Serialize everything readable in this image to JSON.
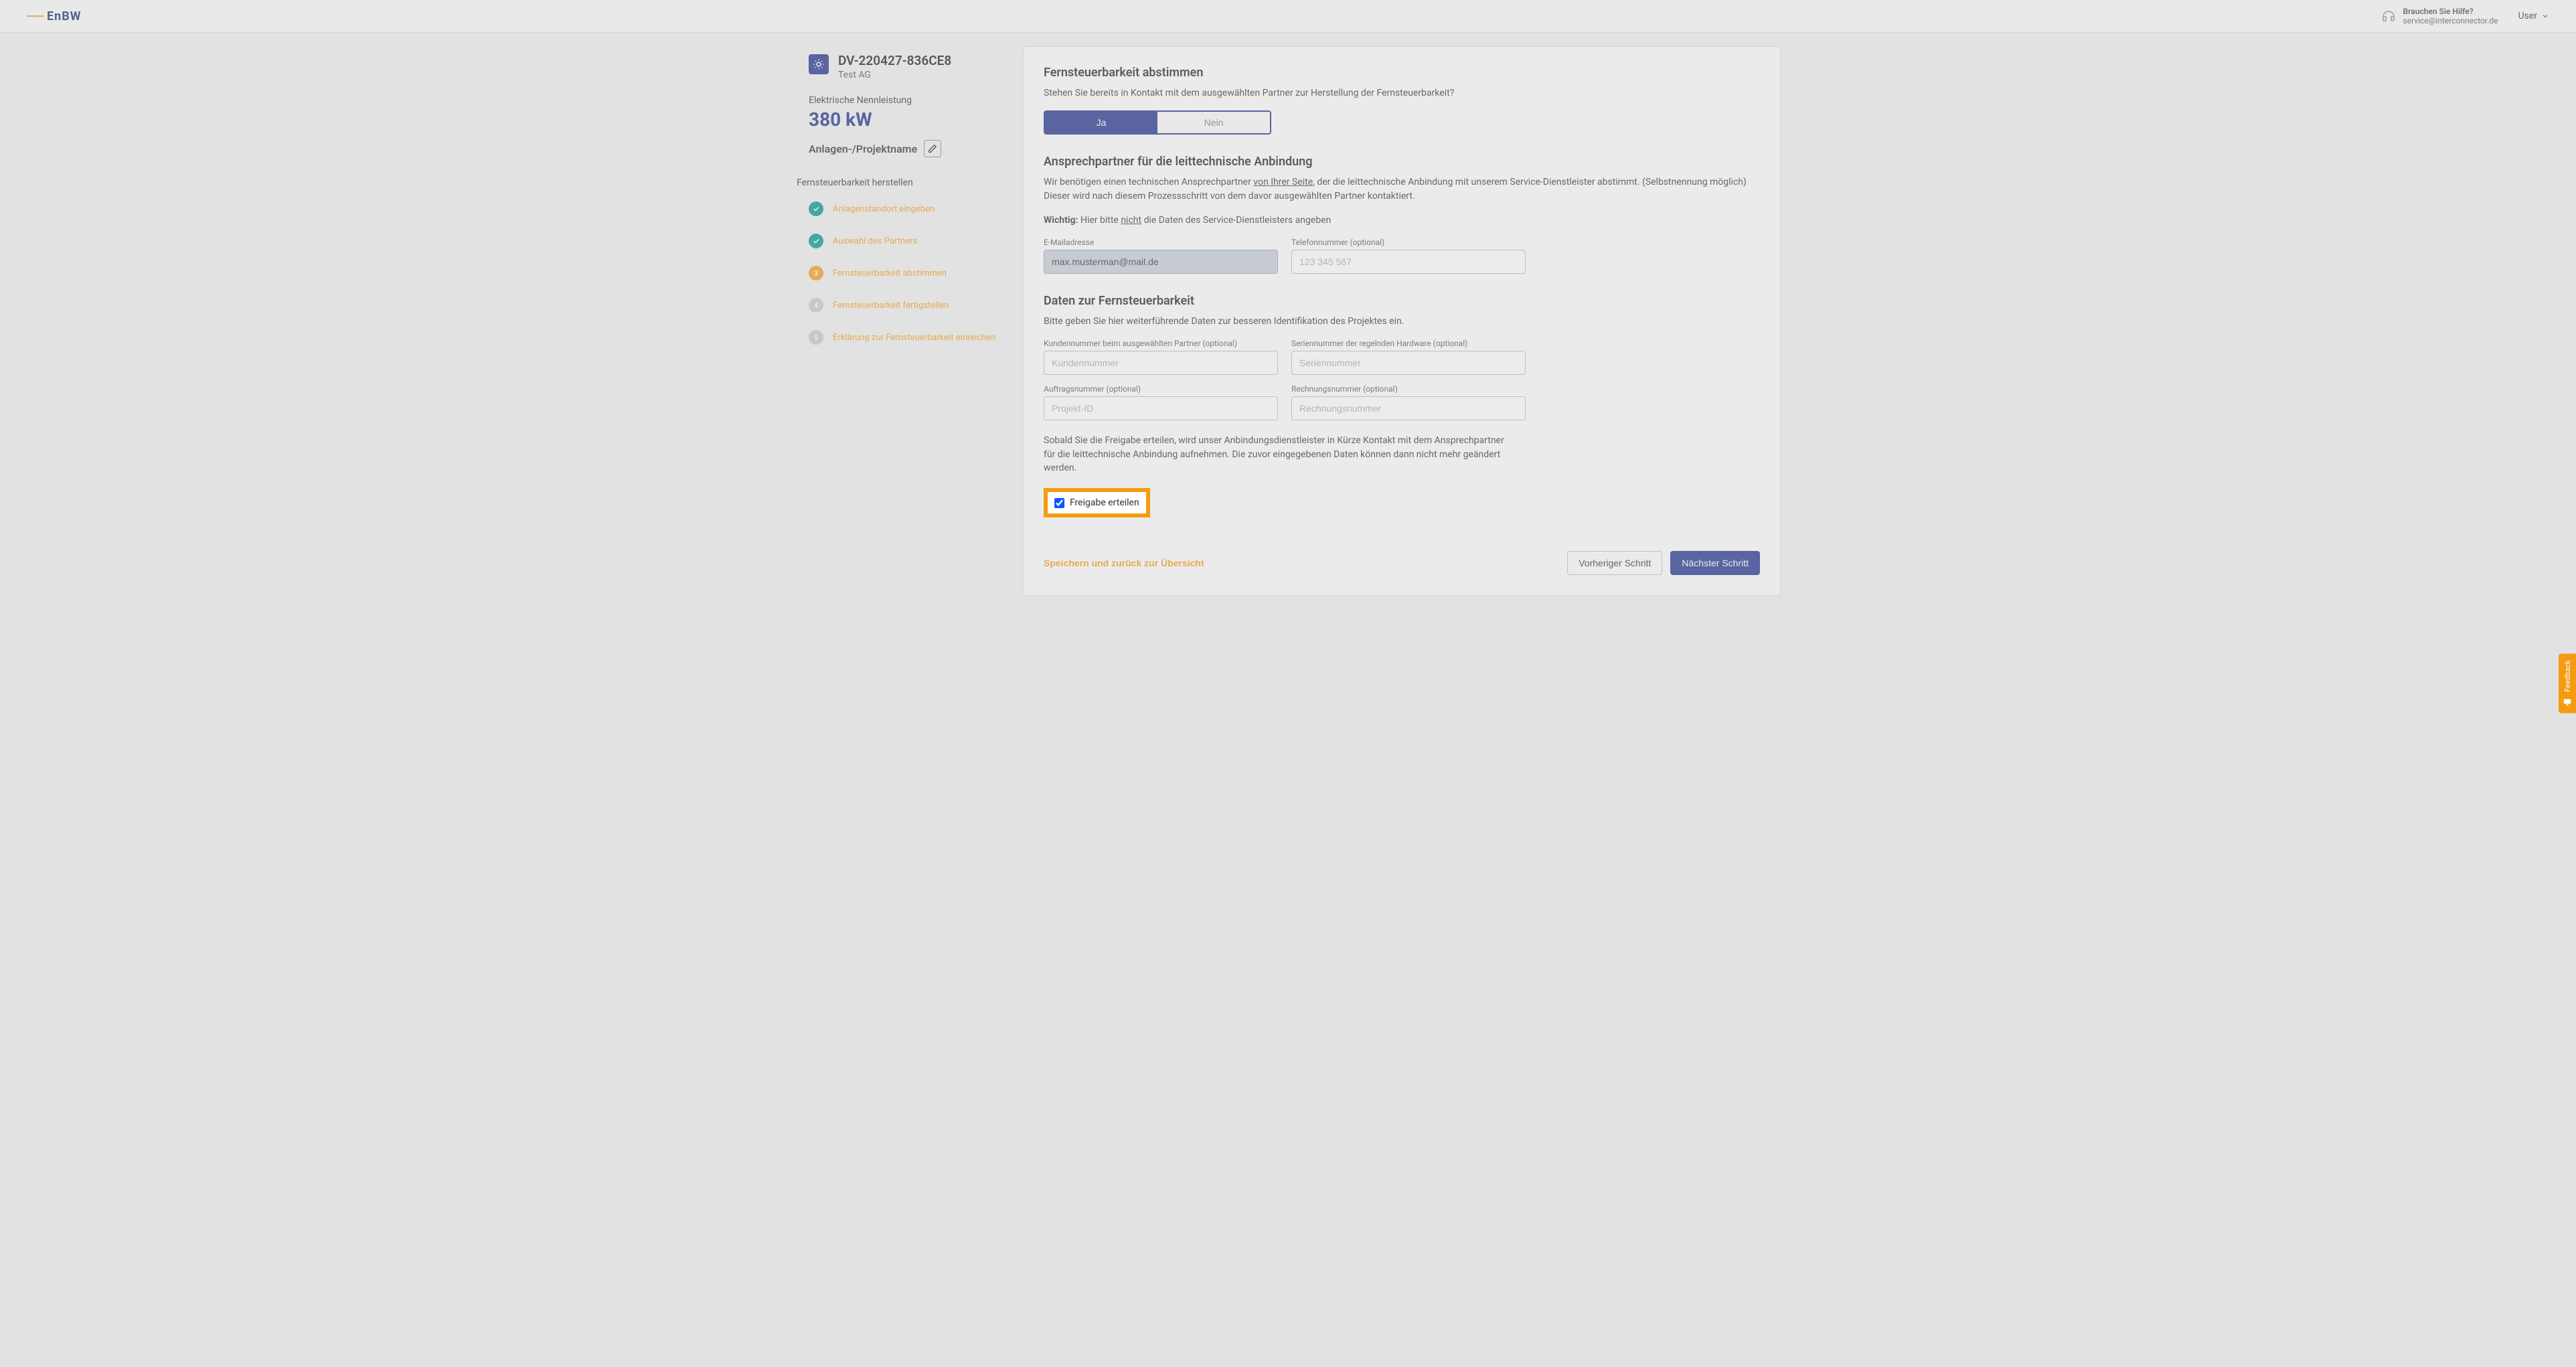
{
  "header": {
    "logo_text": "EnBW",
    "help_title": "Brauchen Sie Hilfe?",
    "help_email": "service@interconnector.de",
    "user_label": "User"
  },
  "sidebar": {
    "project_id": "DV-220427-836CE8",
    "company": "Test AG",
    "power_label": "Elektrische Nennleistung",
    "power_value": "380 kW",
    "project_name": "Anlagen-/Projektname",
    "wizard_title": "Fernsteuerbarkeit herstellen",
    "steps": [
      {
        "label": "Anlagenstandort eingeben",
        "state": "done",
        "num": "✓"
      },
      {
        "label": "Auswahl des Partners",
        "state": "done",
        "num": "✓"
      },
      {
        "label": "Fernsteuerbarkeit abstimmen",
        "state": "current",
        "num": "3"
      },
      {
        "label": "Fernsteuerbarkeit fertigstellen",
        "state": "pending",
        "num": "4"
      },
      {
        "label": "Erklärung zur Fernsteuerbarkeit einreichen",
        "state": "disabled",
        "num": "5"
      }
    ]
  },
  "main": {
    "section1_title": "Fernsteuerbarkeit abstimmen",
    "section1_desc": "Stehen Sie bereits in Kontakt mit dem ausgewählten Partner zur Herstellung der Fernsteuerbarkeit?",
    "toggle_yes": "Ja",
    "toggle_no": "Nein",
    "section2_title": "Ansprechpartner für die leittechnische Anbindung",
    "section2_desc_1": "Wir benötigen einen technischen Ansprechpartner ",
    "section2_desc_u1": "von Ihrer Seite",
    "section2_desc_2": ", der die leittechnische Anbindung mit unserem Service-Dienstleister abstimmt. (Selbstnennung möglich) Dieser wird nach diesem Prozessschritt von dem davor ausgewählten Partner kontaktiert.",
    "section2_note_1": "Wichtig: ",
    "section2_note_2": "Hier bitte ",
    "section2_note_u": "nicht",
    "section2_note_3": " die Daten des Service-Dienstleisters angeben",
    "email_label": "E-Mailadresse",
    "email_value": "max.musterman@mail.de",
    "phone_label": "Telefonnummer (optional)",
    "phone_placeholder": "123 345 567",
    "section3_title": "Daten zur Fernsteuerbarkeit",
    "section3_desc": "Bitte geben Sie hier weiterführende Daten zur besseren Identifikation des Projektes ein.",
    "cust_label": "Kundennummer beim ausgewählten Partner (optional)",
    "cust_placeholder": "Kundennummer",
    "serial_label": "Seriennummer der regelnden Hardware (optional)",
    "serial_placeholder": "Seriennummer",
    "order_label": "Auftragsnummer (optional)",
    "order_placeholder": "Projekt-ID",
    "invoice_label": "Rechnungsnummer (optional)",
    "invoice_placeholder": "Rechnungsnummer",
    "approval_desc": "Sobald Sie die Freigabe erteilen, wird unser Anbindungsdienstleister in Kürze Kontakt mit dem Ansprechpartner für die leittechnische Anbindung aufnehmen. Die zuvor eingegebenen Daten können dann nicht mehr geändert werden.",
    "approval_label": "Freigabe erteilen",
    "save_link": "Speichern und zurück zur Übersicht",
    "prev_btn": "Vorheriger Schritt",
    "next_btn": "Nächster Schritt"
  },
  "feedback": "Feedback"
}
